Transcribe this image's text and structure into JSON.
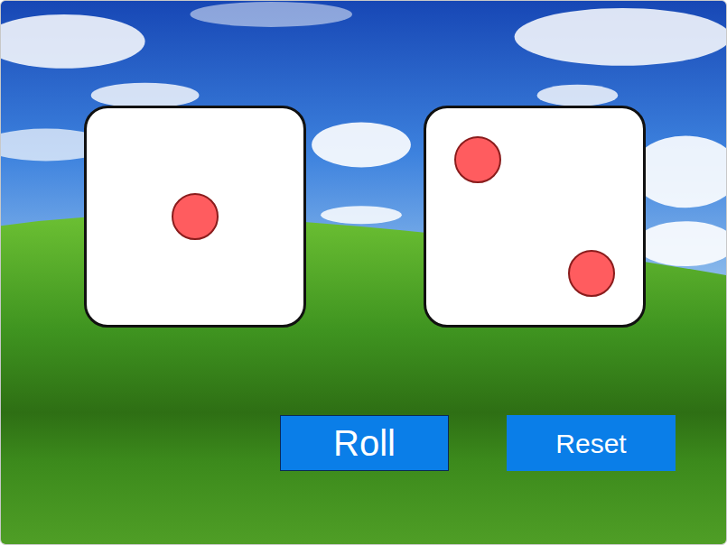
{
  "dice": [
    {
      "face": 1
    },
    {
      "face": 2
    }
  ],
  "buttons": [
    "Roll",
    "Reset"
  ]
}
